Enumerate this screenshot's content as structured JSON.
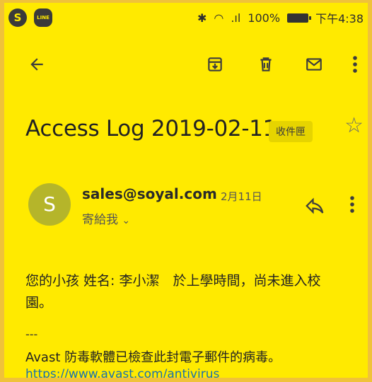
{
  "status_bar": {
    "apps": [
      "S",
      "LINE"
    ],
    "battery": "100%",
    "time": "下午4:38"
  },
  "toolbar": {
    "back_icon": "arrow-left-icon",
    "archive_icon": "archive-icon",
    "delete_icon": "trash-icon",
    "mark_unread_icon": "mail-icon",
    "more_icon": "more-vert-icon"
  },
  "email": {
    "subject": "Access Log 2019-02-11",
    "label": "收件匣",
    "sender": "sales@soyal.com",
    "avatar_letter": "S",
    "date": "2月11日",
    "recipient": "寄給我",
    "body_line1": "您的小孩 姓名: 李小潔　於上學時間，尚未進入校",
    "body_line2": "園。",
    "separator": "---",
    "avast_text": "Avast 防毒軟體已檢查此封電子郵件的病毒。",
    "avast_link": "https://www.avast.com/antivirus"
  },
  "colors": {
    "background": "#ffea00",
    "avatar": "#b5b52a",
    "link": "#1a6fb0"
  }
}
